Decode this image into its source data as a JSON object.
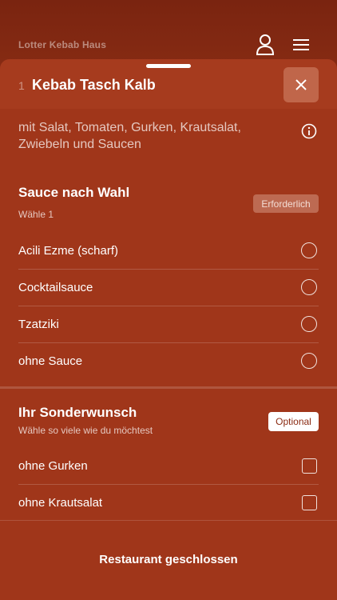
{
  "header": {
    "restaurant_name": "Lotter Kebab Haus",
    "icons": [
      "user-icon",
      "menu-icon"
    ]
  },
  "item": {
    "quantity": "1",
    "title": "Kebab Tasch Kalb",
    "description": "mit Salat, Tomaten, Gurken, Krautsalat, Zwiebeln und Saucen"
  },
  "sauce_section": {
    "title": "Sauce nach Wahl",
    "subtitle": "Wähle 1",
    "badge": "Erforderlich",
    "options": [
      "Acili Ezme (scharf)",
      "Cocktailsauce",
      "Tzatziki",
      "ohne Sauce"
    ]
  },
  "wish_section": {
    "title": "Ihr Sonderwunsch",
    "subtitle": "Wähle so viele wie du möchtest",
    "badge": "Optional",
    "options": [
      "ohne Gurken",
      "ohne Krautsalat"
    ]
  },
  "footer": {
    "label": "Restaurant geschlossen"
  },
  "colors": {
    "background": "#8a2a12",
    "sheet": "#a0361a",
    "close_button": "#c0664a"
  }
}
